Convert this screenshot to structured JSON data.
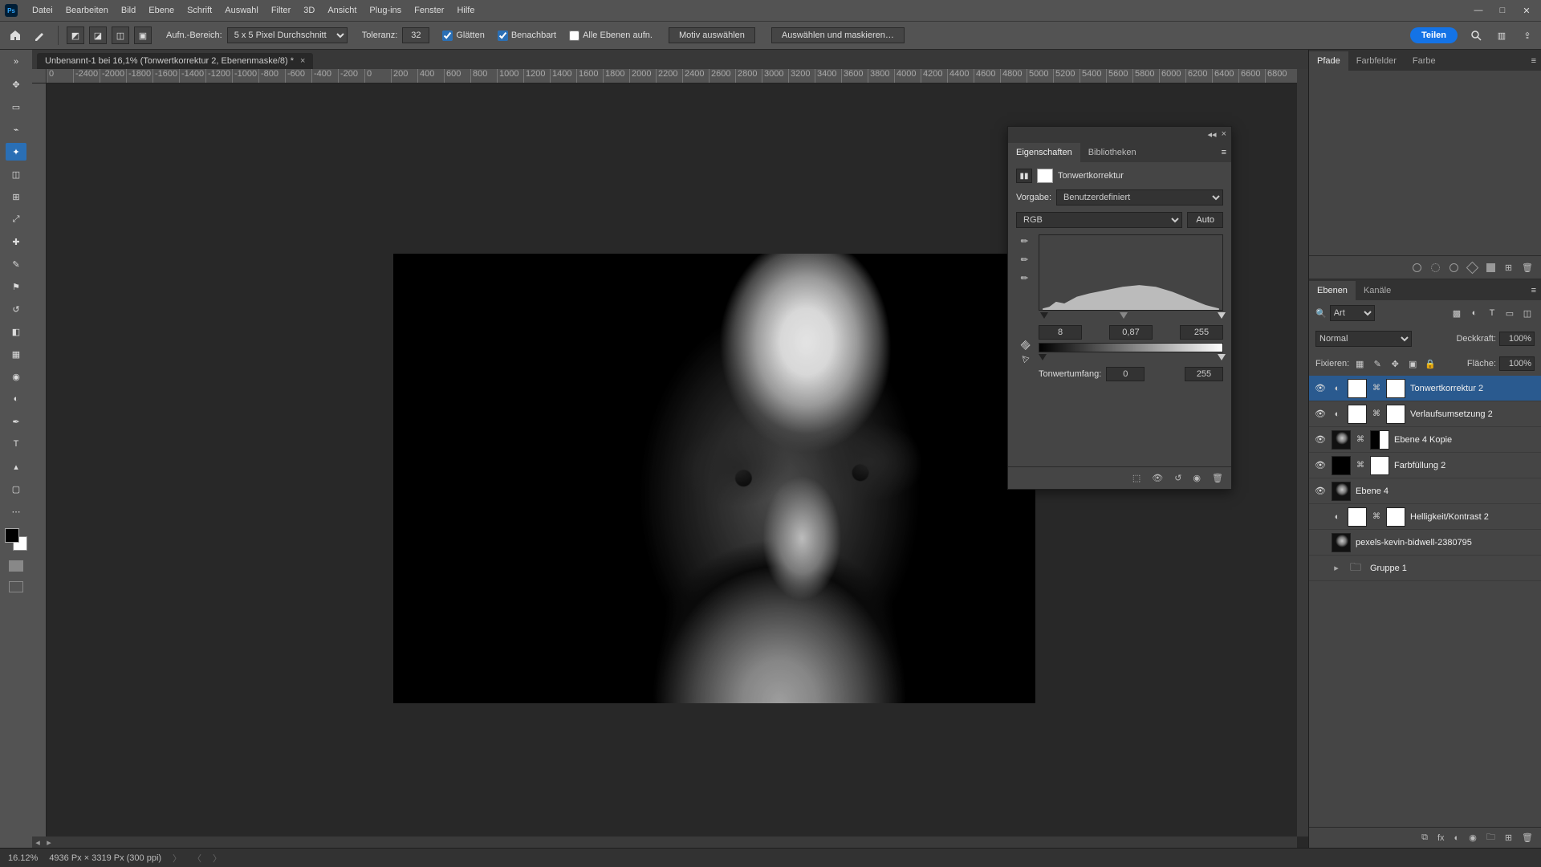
{
  "menu": {
    "items": [
      "Datei",
      "Bearbeiten",
      "Bild",
      "Ebene",
      "Schrift",
      "Auswahl",
      "Filter",
      "3D",
      "Ansicht",
      "Plug-ins",
      "Fenster",
      "Hilfe"
    ]
  },
  "optbar": {
    "sample_label": "Aufn.-Bereich:",
    "sample_value": "5 x 5 Pixel Durchschnitt",
    "tolerance_label": "Toleranz:",
    "tolerance_value": "32",
    "antialias": {
      "label": "Glätten",
      "checked": true
    },
    "contiguous": {
      "label": "Benachbart",
      "checked": true
    },
    "all_layers": {
      "label": "Alle Ebenen aufn.",
      "checked": false
    },
    "select_subject": "Motiv auswählen",
    "select_mask": "Auswählen und maskieren…",
    "share": "Teilen"
  },
  "doc": {
    "tab_title": "Unbenannt-1 bei 16,1% (Tonwertkorrektur 2, Ebenenmaske/8) *",
    "ruler_ticks": [
      "0",
      "-2400",
      "-2000",
      "-1800",
      "-1600",
      "-1400",
      "-1200",
      "-1000",
      "-800",
      "-600",
      "-400",
      "-200",
      "0",
      "200",
      "400",
      "600",
      "800",
      "1000",
      "1200",
      "1400",
      "1600",
      "1800",
      "2000",
      "2200",
      "2400",
      "2600",
      "2800",
      "3000",
      "3200",
      "3400",
      "3600",
      "3800",
      "4000",
      "4200",
      "4400",
      "4600",
      "4800",
      "5000",
      "5200",
      "5400",
      "5600",
      "5800",
      "6000",
      "6200",
      "6400",
      "6600",
      "6800"
    ]
  },
  "props": {
    "tab_props": "Eigenschaften",
    "tab_libs": "Bibliotheken",
    "adj_name": "Tonwertkorrektur",
    "preset_label": "Vorgabe:",
    "preset_value": "Benutzerdefiniert",
    "channel_value": "RGB",
    "auto_label": "Auto",
    "black": "8",
    "gamma": "0,87",
    "white": "255",
    "output_label": "Tonwertumfang:",
    "out_black": "0",
    "out_white": "255"
  },
  "right_tabs": {
    "paths": "Pfade",
    "swatches": "Farbfelder",
    "color": "Farbe"
  },
  "layers": {
    "tab_layers": "Ebenen",
    "tab_channels": "Kanäle",
    "filter_label": "Art",
    "blend_mode": "Normal",
    "opacity_label": "Deckkraft:",
    "opacity_value": "100%",
    "lock_label": "Fixieren:",
    "fill_label": "Fläche:",
    "fill_value": "100%",
    "items": [
      {
        "vis": true,
        "adj": true,
        "link": true,
        "thumb": "mask",
        "sel": true,
        "name": "Tonwertkorrektur 2"
      },
      {
        "vis": true,
        "adj": true,
        "link": true,
        "thumb": "mask",
        "name": "Verlaufsumsetzung 2"
      },
      {
        "vis": true,
        "adj": false,
        "link": true,
        "thumb": "imgbw",
        "mask2": "maskhalf",
        "name": "Ebene 4 Kopie"
      },
      {
        "vis": true,
        "adj": false,
        "link": true,
        "thumb": "maskb",
        "mask2": "mask",
        "name": "Farbfüllung 2"
      },
      {
        "vis": true,
        "adj": false,
        "link": false,
        "thumb": "imgbw",
        "name": "Ebene 4"
      },
      {
        "vis": false,
        "adj": true,
        "link": true,
        "thumb": "mask",
        "name": "Helligkeit/Kontrast 2"
      },
      {
        "vis": false,
        "adj": false,
        "link": false,
        "thumb": "imgbw",
        "name": "pexels-kevin-bidwell-2380795"
      },
      {
        "vis": false,
        "folder": true,
        "name": "Gruppe 1"
      }
    ]
  },
  "status": {
    "zoom": "16.12%",
    "dims": "4936 Px × 3319 Px (300 ppi)"
  }
}
